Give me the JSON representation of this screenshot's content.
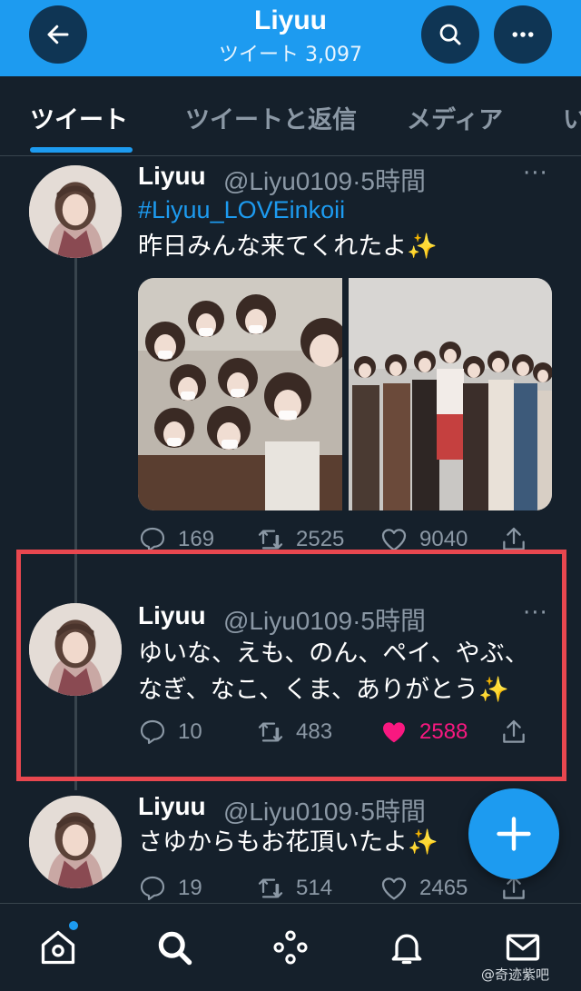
{
  "header": {
    "title": "Liyuu",
    "subtitle": "ツイート 3,097"
  },
  "tabs": [
    {
      "label": "ツイート",
      "active": true
    },
    {
      "label": "ツイートと返信",
      "active": false
    },
    {
      "label": "メディア",
      "active": false
    },
    {
      "label": "い",
      "active": false
    }
  ],
  "tweets": [
    {
      "name": "Liyuu",
      "handle": "@Liyu0109",
      "separator": "·",
      "time": "5時間",
      "hashtag": "#Liyuu_LOVEinkoii",
      "lines": [
        "昨日みんな来てくれたよ"
      ],
      "emoji": "✨",
      "replies": "169",
      "retweets": "2525",
      "likes": "9040",
      "liked": false,
      "media": [
        "photo",
        "photo"
      ]
    },
    {
      "name": "Liyuu",
      "handle": "@Liyu0109",
      "separator": "·",
      "time": "5時間",
      "lines": [
        "ゆいな、えも、のん、ペイ、やぶ、",
        "なぎ、なこ、くま、ありがとう"
      ],
      "emoji": "✨",
      "replies": "10",
      "retweets": "483",
      "likes": "2588",
      "liked": true
    },
    {
      "name": "Liyuu",
      "handle": "@Liyu0109",
      "separator": "·",
      "time": "5時間",
      "lines": [
        "さゆからもお花頂いたよ"
      ],
      "emoji": "✨",
      "replies": "19",
      "retweets": "514",
      "likes": "2465",
      "liked": false
    }
  ],
  "more_glyph": "···",
  "colors": {
    "accent": "#1d9bf0",
    "background": "#15202b",
    "like": "#f91880",
    "highlight_box": "#e8474f",
    "muted_text": "#8b98a5"
  },
  "bottom_nav": [
    "home-icon",
    "search-icon",
    "spaces-icon",
    "notifications-icon",
    "messages-icon"
  ],
  "watermark": "@奇迹紫吧"
}
